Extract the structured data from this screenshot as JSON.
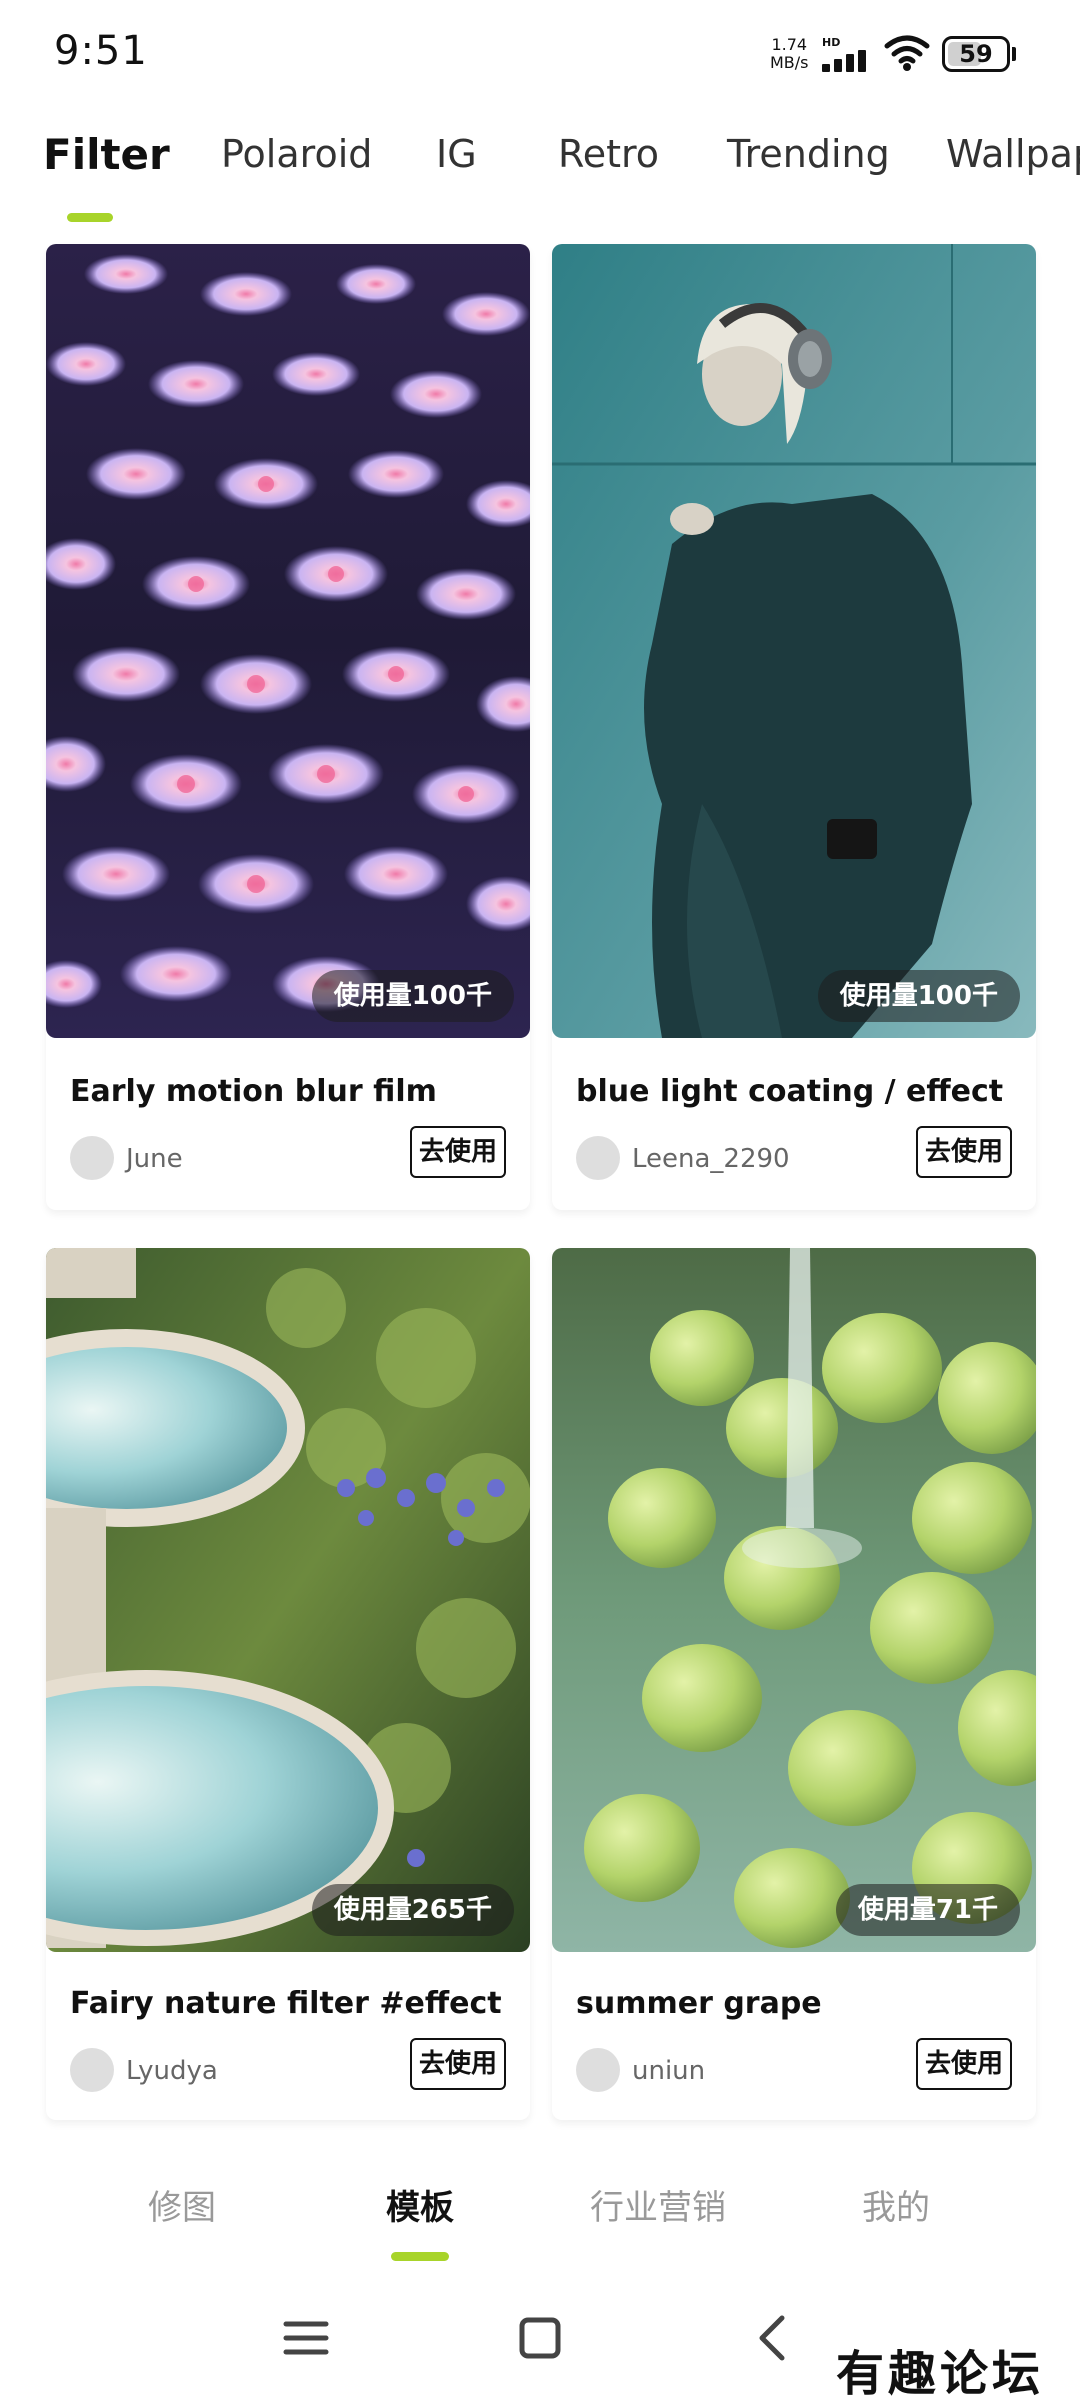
{
  "status_bar": {
    "time": "9:51",
    "net_speed_value": "1.74",
    "net_speed_unit": "MB/s",
    "hd_label": "HD",
    "battery_level": "59"
  },
  "tabs": {
    "items": [
      "Filter",
      "Polaroid",
      "IG",
      "Retro",
      "Trending",
      "Wallpap"
    ],
    "active": "Filter",
    "accent_color": "#a8d42a"
  },
  "cards": [
    {
      "title": "Early motion blur film",
      "author": "June",
      "usage": "使用量100千",
      "button": "去使用"
    },
    {
      "title": "blue light coating / effect",
      "author": "Leena_2290",
      "usage": "使用量100千",
      "button": "去使用"
    },
    {
      "title": "Fairy nature filter #effect",
      "author": "Lyudya",
      "usage": "使用量265千",
      "button": "去使用"
    },
    {
      "title": "summer grape",
      "author": "uniun",
      "usage": "使用量71千",
      "button": "去使用"
    }
  ],
  "bottom_nav": {
    "items": [
      "修图",
      "模板",
      "行业营销",
      "我的"
    ],
    "active": "模板"
  },
  "system_nav": {
    "icons": [
      "menu-icon",
      "home-icon",
      "back-icon"
    ]
  },
  "watermark": "有趣论坛"
}
